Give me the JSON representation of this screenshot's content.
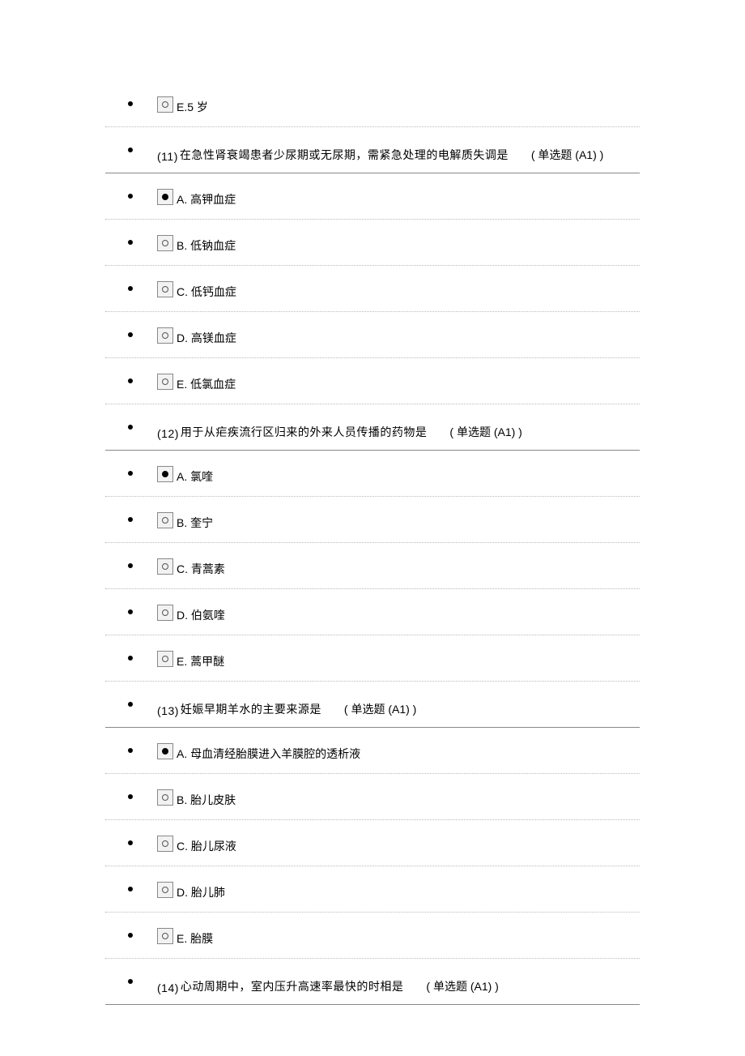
{
  "orphan_option": {
    "label": "E.5 岁"
  },
  "questions": [
    {
      "number": "(11)",
      "stem": "在急性肾衰竭患者少尿期或无尿期，需紧急处理的电解质失调是",
      "type": "( 单选题 (A1) )",
      "options": [
        {
          "label": "A. 高钾血症",
          "selected": true
        },
        {
          "label": "B. 低钠血症",
          "selected": false
        },
        {
          "label": "C. 低钙血症",
          "selected": false
        },
        {
          "label": "D. 高镁血症",
          "selected": false
        },
        {
          "label": "E. 低氯血症",
          "selected": false
        }
      ]
    },
    {
      "number": "(12)",
      "stem": "用于从疟疾流行区归来的外来人员传播的药物是",
      "type": "( 单选题 (A1) )",
      "options": [
        {
          "label": "A. 氯喹",
          "selected": true
        },
        {
          "label": "B. 奎宁",
          "selected": false
        },
        {
          "label": "C. 青蒿素",
          "selected": false
        },
        {
          "label": "D. 伯氨喹",
          "selected": false
        },
        {
          "label": "E. 蒿甲醚",
          "selected": false
        }
      ]
    },
    {
      "number": "(13)",
      "stem": "妊娠早期羊水的主要来源是",
      "type": "( 单选题  (A1) )",
      "options": [
        {
          "label": "A. 母血清经胎膜进入羊膜腔的透析液",
          "selected": true
        },
        {
          "label": "B. 胎儿皮肤",
          "selected": false
        },
        {
          "label": "C. 胎儿尿液",
          "selected": false
        },
        {
          "label": "D. 胎儿肺",
          "selected": false
        },
        {
          "label": "E. 胎膜",
          "selected": false
        }
      ]
    },
    {
      "number": "(14)",
      "stem": "心动周期中，室内压升高速率最快的时相是",
      "type": "( 单选题  (A1) )",
      "options": []
    }
  ]
}
